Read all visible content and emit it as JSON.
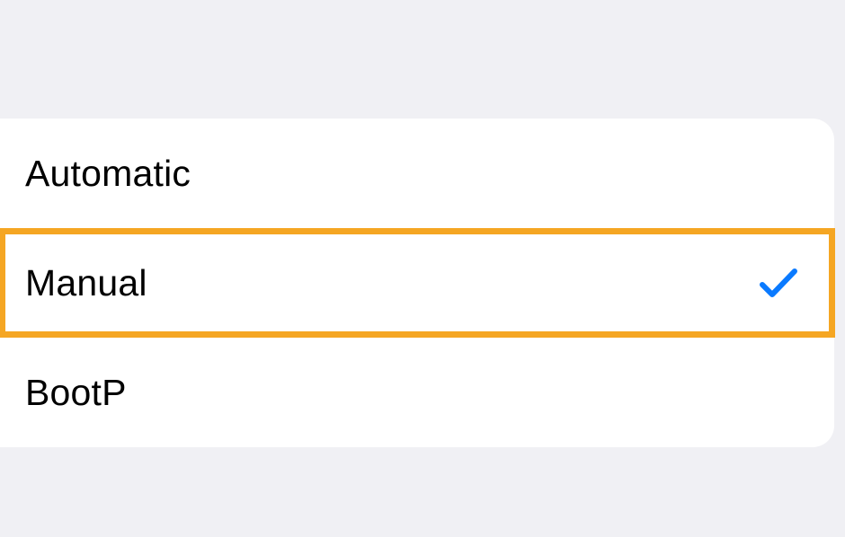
{
  "options": [
    {
      "label": "Automatic",
      "selected": false,
      "highlighted": false
    },
    {
      "label": "Manual",
      "selected": true,
      "highlighted": true
    },
    {
      "label": "BootP",
      "selected": false,
      "highlighted": false
    }
  ],
  "colors": {
    "background": "#f0f0f4",
    "listBackground": "#ffffff",
    "highlightBorder": "#f5a623",
    "checkmark": "#0a7aff"
  }
}
